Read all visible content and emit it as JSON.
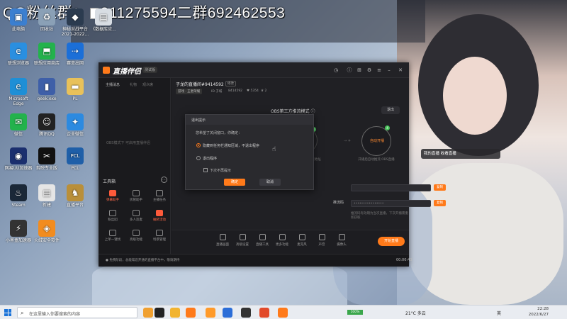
{
  "watermark": {
    "left": "QQ粉丝群：",
    "mid": "811275594",
    "right": "二群692462553"
  },
  "desktop_icons": [
    {
      "label": "此电脑",
      "color": "#3b7fd0",
      "glyph": "▣"
    },
    {
      "label": "回收站",
      "color": "#8aa0b6",
      "glyph": "♻"
    },
    {
      "label": "神秘对战平台 2021-2022...",
      "color": "#2b3b4f",
      "glyph": "◆"
    },
    {
      "label": "《数据库应...",
      "color": "#d8dde3",
      "glyph": "▤"
    },
    {
      "label": "联想浏览器",
      "color": "#2a8fe0",
      "glyph": "e"
    },
    {
      "label": "联想应用商店",
      "color": "#23b24c",
      "glyph": "⬒"
    },
    {
      "label": "赛意出网",
      "color": "#1b6fd8",
      "glyph": "⇢"
    },
    {
      "label": "Microsoft Edge",
      "color": "#1e8fd6",
      "glyph": "e"
    },
    {
      "label": "geek.exe",
      "color": "#3e5fa8",
      "glyph": "▮"
    },
    {
      "label": "PL",
      "color": "#e8c15a",
      "glyph": "▬"
    },
    {
      "label": "微信",
      "color": "#23b24c",
      "glyph": "✉"
    },
    {
      "label": "腾讯QQ",
      "color": "#222",
      "glyph": "☺"
    },
    {
      "label": "企业微信",
      "color": "#2c8ae0",
      "glyph": "✦"
    },
    {
      "label": "网易UU加速器",
      "color": "#1b2f6e",
      "glyph": "◉"
    },
    {
      "label": "剪映专业版",
      "color": "#111",
      "glyph": "✂"
    },
    {
      "label": "PCL",
      "color": "#1f5fa8",
      "glyph": "PCL"
    },
    {
      "label": "Steam",
      "color": "#1b2838",
      "glyph": "♨"
    },
    {
      "label": "新建",
      "color": "#e5e5e5",
      "glyph": "▤"
    },
    {
      "label": "直播平台",
      "color": "#b98f3a",
      "glyph": "♞"
    },
    {
      "label": "小黑盒加速器",
      "color": "#333",
      "glyph": "⚡"
    },
    {
      "label": "火绒安全软件",
      "color": "#f28c1f",
      "glyph": "◈"
    }
  ],
  "app": {
    "title": "直播伴侣",
    "version": "测试版",
    "left_tabs": [
      "主播消息",
      "礼物",
      "观众席"
    ],
    "chat_hint": "OBS模式下 可启用直播伴侣",
    "tools_label": "工具箱",
    "tools_more": "⋯",
    "tools": [
      {
        "label": "弹幕助手",
        "hot": true
      },
      {
        "label": "房管助手",
        "hot": false
      },
      {
        "label": "主播任务",
        "hot": false
      },
      {
        "label": "粉丝团",
        "hot": false
      },
      {
        "label": "多人连麦",
        "hot": false
      },
      {
        "label": "抽奖活动",
        "hot": true
      },
      {
        "label": "上单一键找",
        "hot": false
      },
      {
        "label": "高级功能",
        "hot": false
      },
      {
        "label": "场景管理",
        "hot": false
      }
    ],
    "footer_note": "● 免费阶段，总能帮您开通的直播平台中，敬请期待",
    "room": {
      "title": "子龙的直播间#9414592",
      "badge": "修改",
      "category": "游戏 · 王者荣耀",
      "host": "ID 子城",
      "room_id": "8414592",
      "fans": "♥ 5354",
      "followers": "♛ 2"
    },
    "mode_title": "OBS第三方推流模式 ⓘ",
    "toggle": "退出",
    "step1_num": "3",
    "step2_num": "4",
    "step2_label": "自动开播",
    "step1_desc": "在OBS中添加推流地址",
    "step2_desc": "开播后自动推流 OBS直播",
    "arrow_mid": "→ ✈",
    "server_placeholder": "",
    "copy_label": "复制",
    "key_label": "推流码",
    "key_value": "••••••••••••••••",
    "tip": "推流码有效期为当次直播，下次开播需重新获取",
    "bottom_items": [
      "直播画面",
      "高级设置",
      "直播工具",
      "更多功能",
      "麦克风",
      "声音",
      "摄像头"
    ],
    "go_live": "开始直播",
    "time": "00:00:43"
  },
  "dialog": {
    "title": "退出提示",
    "question": "您希望了关闭窗口，你确定：",
    "option1": "隐藏到任务栏通知区域，不退出程序",
    "option2": "退出程序",
    "checkbox": "下次不再提示",
    "ok": "确定",
    "cancel": "取消"
  },
  "right_badge": "我的直播 收看直播",
  "taskbar": {
    "search_placeholder": "在这里输入你要搜索的内容",
    "battery": "100%",
    "weather": "21°C 多云",
    "lang": "英",
    "time": "22:28",
    "date": "2022/6/27"
  }
}
